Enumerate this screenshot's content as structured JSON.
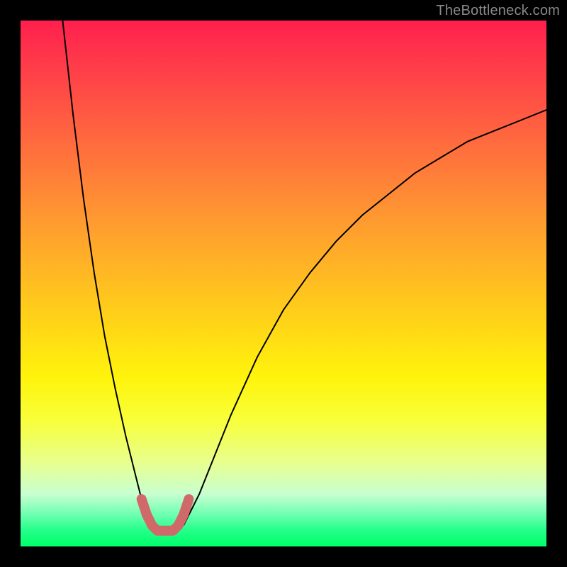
{
  "watermark": "TheBottleneck.com",
  "chart_data": {
    "type": "line",
    "title": "",
    "xlabel": "",
    "ylabel": "",
    "xlim": [
      0,
      100
    ],
    "ylim": [
      0,
      100
    ],
    "series": [
      {
        "name": "curve-left",
        "x": [
          8,
          10,
          12,
          14,
          16,
          18,
          20,
          22,
          23,
          24,
          25
        ],
        "y": [
          100,
          82,
          66,
          52,
          40,
          30,
          21,
          13,
          9,
          6,
          4
        ]
      },
      {
        "name": "curve-right",
        "x": [
          31,
          32,
          34,
          36,
          40,
          45,
          50,
          55,
          60,
          65,
          70,
          75,
          80,
          85,
          90,
          95,
          100
        ],
        "y": [
          4,
          6,
          10,
          15,
          25,
          36,
          45,
          52,
          58,
          63,
          67,
          71,
          74,
          77,
          79,
          81,
          83
        ]
      },
      {
        "name": "marker",
        "x": [
          23,
          24,
          25,
          26,
          27,
          28,
          29,
          30,
          31,
          32
        ],
        "y": [
          9,
          6,
          4,
          3,
          3,
          3,
          3,
          4,
          6,
          9
        ]
      }
    ],
    "marker_color": "#d06a6a",
    "curve_color": "#000000"
  }
}
